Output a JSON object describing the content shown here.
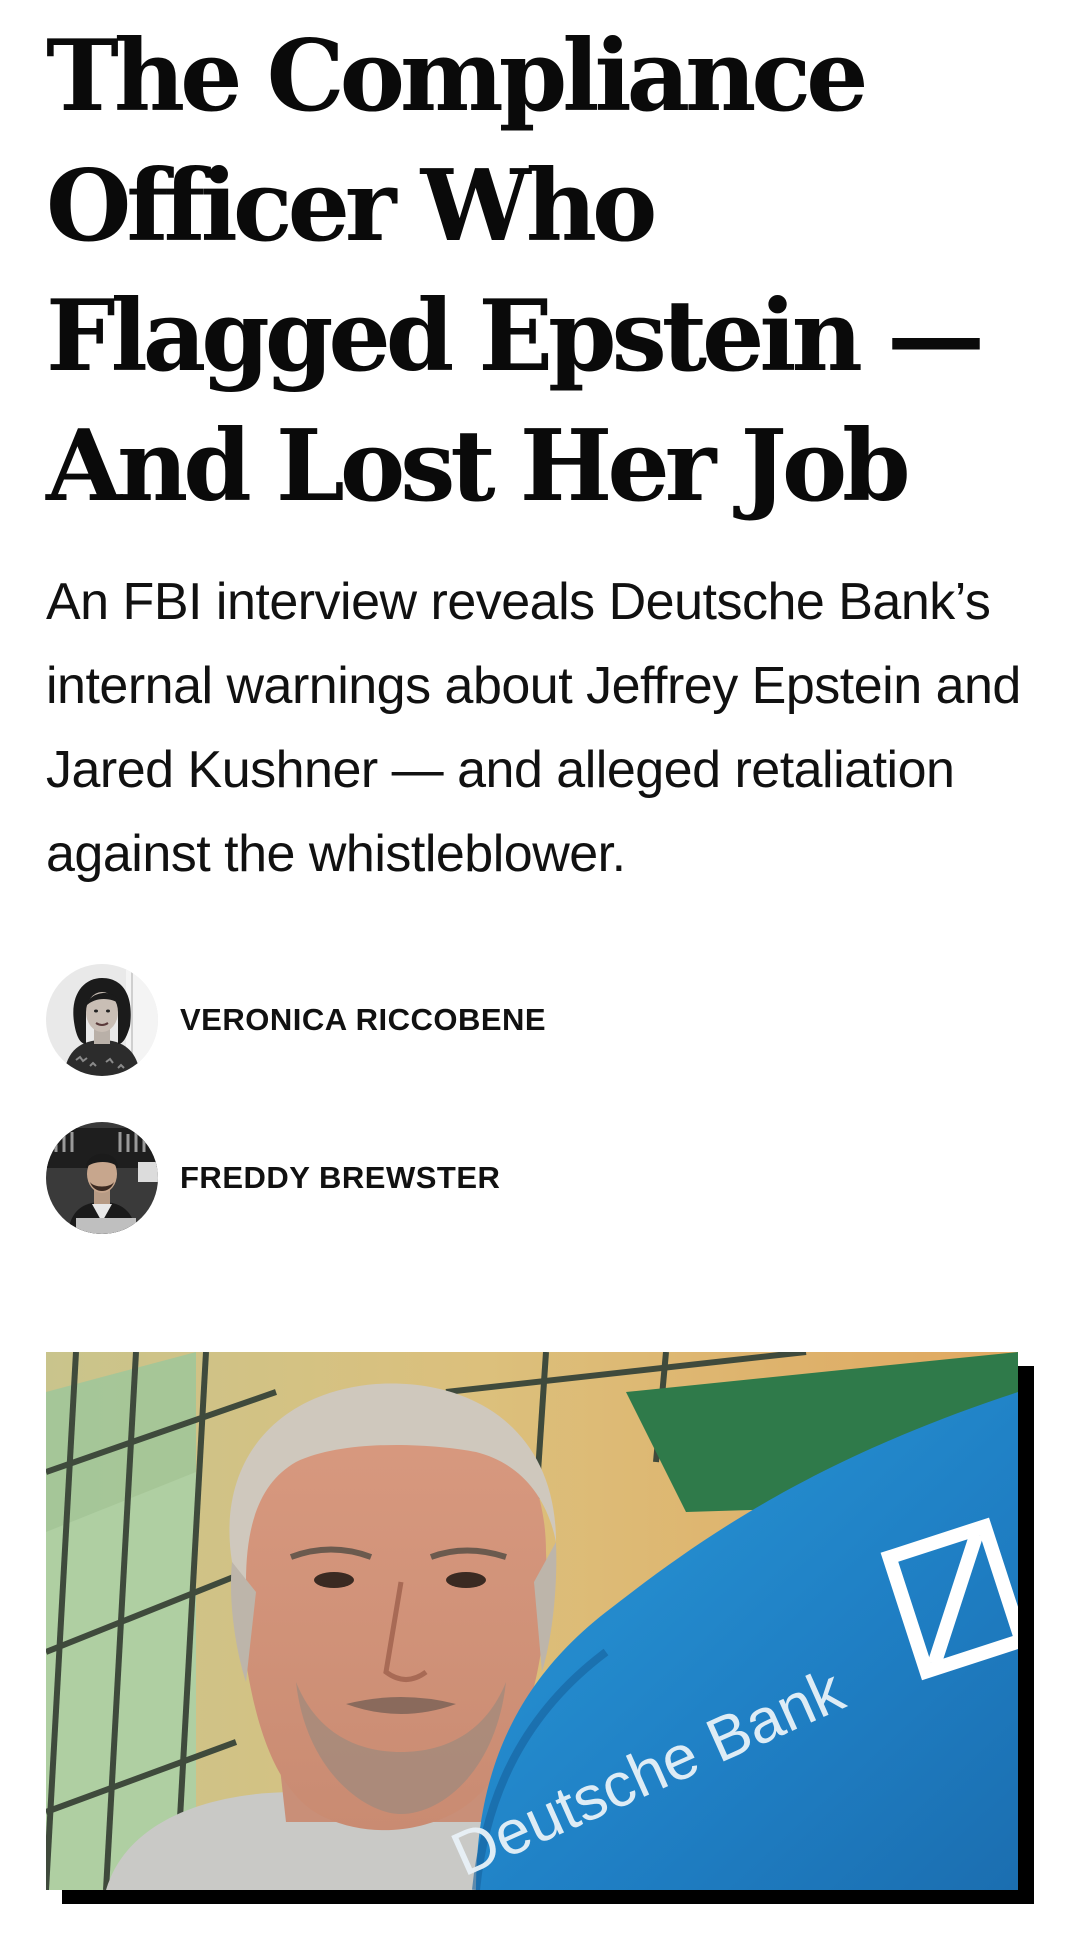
{
  "article": {
    "headline": "The Compliance Officer Who Flagged Epstein — And Lost Her Job",
    "dek": "An FBI interview reveals Deutsche Bank’s internal warnings about Jeffrey Epstein and Jared Kushner — and alleged retaliation against the whistleblower."
  },
  "authors": [
    {
      "name": "VERONICA RICCOBENE",
      "avatar_icon": "author-photo-woman"
    },
    {
      "name": "FREDDY BREWSTER",
      "avatar_icon": "author-photo-man"
    }
  ],
  "hero_image": {
    "flag_text": "Deutsche Bank",
    "colors": {
      "flag_blue": "#1f7fc4",
      "background_warm": "#d8b773",
      "accent_green": "#9fc79a",
      "frame_shadow": "#000000"
    }
  }
}
